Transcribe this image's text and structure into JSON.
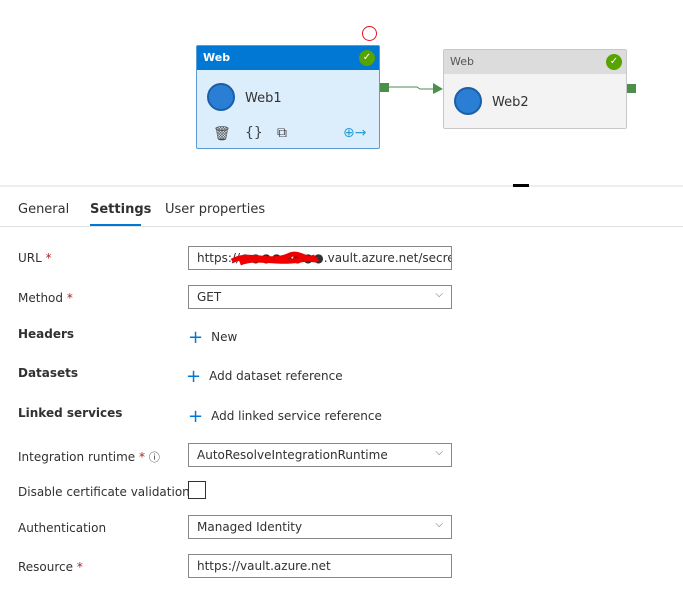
{
  "canvas": {
    "activities": [
      {
        "type": "Web",
        "name": "Web1",
        "status": "succeeded",
        "selected": true
      },
      {
        "type": "Web",
        "name": "Web2",
        "status": "succeeded",
        "selected": false
      }
    ],
    "colors": {
      "selected_header": "#0078d4",
      "success": "#57a300",
      "connector": "#4b8f4b"
    }
  },
  "tabs": [
    {
      "label": "General"
    },
    {
      "label": "Settings",
      "active": true
    },
    {
      "label": "User properties"
    }
  ],
  "settings": {
    "url": {
      "label": "URL",
      "required": "*",
      "value": "https://●●●●●●●●.vault.azure.net/secrets"
    },
    "method": {
      "label": "Method",
      "required": "*",
      "value": "GET"
    },
    "headers": {
      "label": "Headers",
      "action": "New"
    },
    "datasets": {
      "label": "Datasets",
      "action": "Add dataset reference"
    },
    "linked_services": {
      "label": "Linked services",
      "action": "Add linked service reference"
    },
    "integration_runtime": {
      "label": "Integration runtime",
      "required": "*",
      "value": "AutoResolveIntegrationRuntime"
    },
    "disable_cert": {
      "label": "Disable certificate validation",
      "checked": false
    },
    "authentication": {
      "label": "Authentication",
      "value": "Managed Identity"
    },
    "resource": {
      "label": "Resource",
      "required": "*",
      "value": "https://vault.azure.net"
    }
  }
}
